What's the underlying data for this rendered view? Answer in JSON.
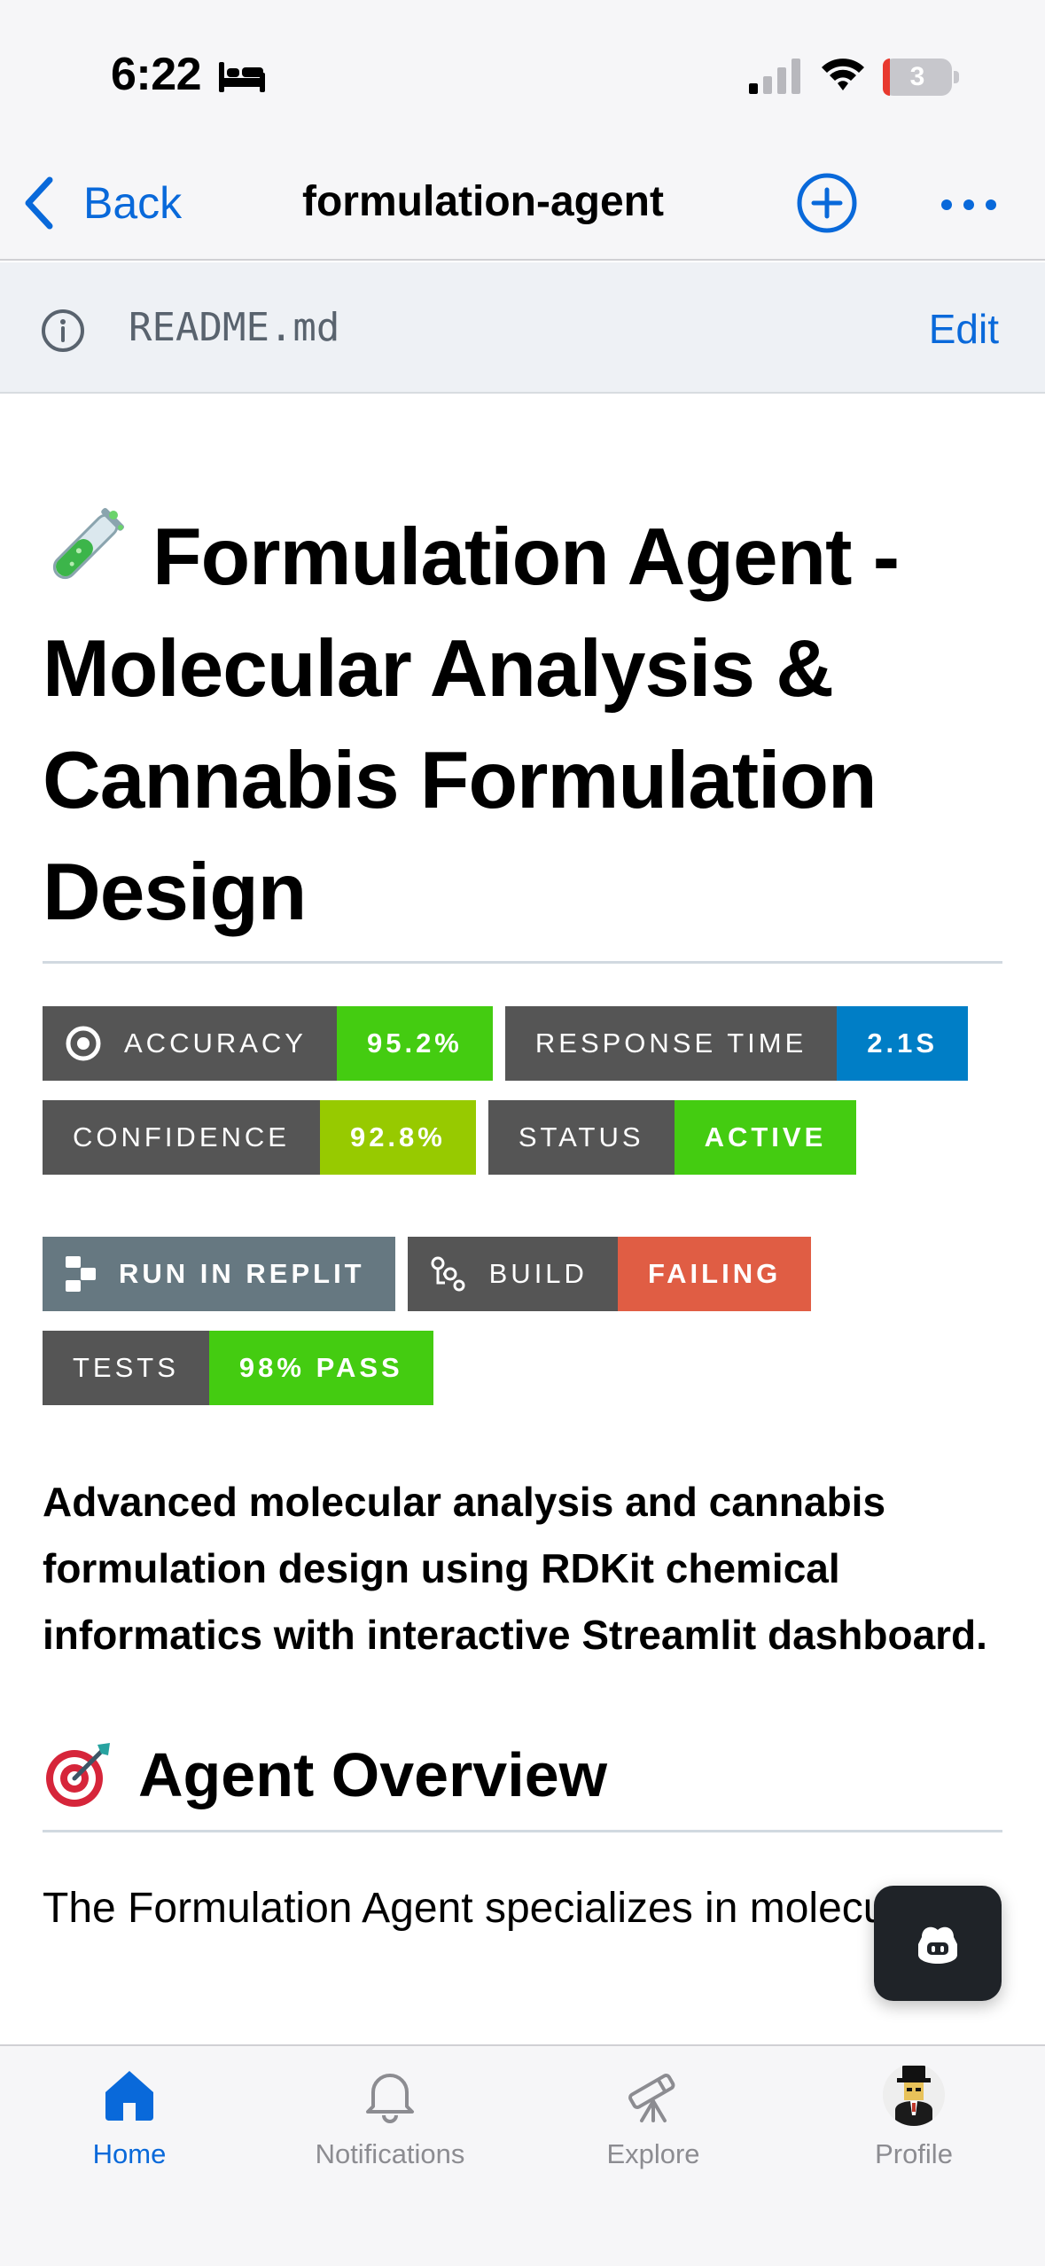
{
  "status_bar": {
    "time": "6:22",
    "battery": "3"
  },
  "nav": {
    "back_label": "Back",
    "title": "formulation-agent"
  },
  "readme_bar": {
    "file_name": "README.md",
    "edit_label": "Edit"
  },
  "readme": {
    "title": "Formulation Agent - Molecular Analysis & Cannabis Formulation Design",
    "badges": [
      {
        "label": "ACCURACY",
        "value": "95.2%",
        "color": "#4c1"
      },
      {
        "label": "RESPONSE TIME",
        "value": "2.1S",
        "color": "#007ec6"
      },
      {
        "label": "CONFIDENCE",
        "value": "92.8%",
        "color": "#97ca00"
      },
      {
        "label": "STATUS",
        "value": "ACTIVE",
        "color": "#4c1"
      }
    ],
    "replit_badge": {
      "label": "RUN IN REPLIT",
      "color": "#667881"
    },
    "build_badge": {
      "label": "BUILD",
      "value": "FAILING",
      "color": "#e05d44"
    },
    "tests_badge": {
      "label": "TESTS",
      "value": "98% PASS",
      "color": "#4c1"
    },
    "description": "Advanced molecular analysis and cannabis formulation design using RDKit chemical informatics with interactive Streamlit dashboard.",
    "section_title": "Agent Overview",
    "overview_text": "The Formulation Agent specializes in molecular"
  },
  "tabs": [
    {
      "label": "Home",
      "icon": "home-icon",
      "active": true
    },
    {
      "label": "Notifications",
      "icon": "bell-icon",
      "active": false
    },
    {
      "label": "Explore",
      "icon": "telescope-icon",
      "active": false
    },
    {
      "label": "Profile",
      "icon": "avatar",
      "active": false
    }
  ],
  "colors": {
    "accent": "#0969da",
    "inactive": "#8c8c91"
  }
}
